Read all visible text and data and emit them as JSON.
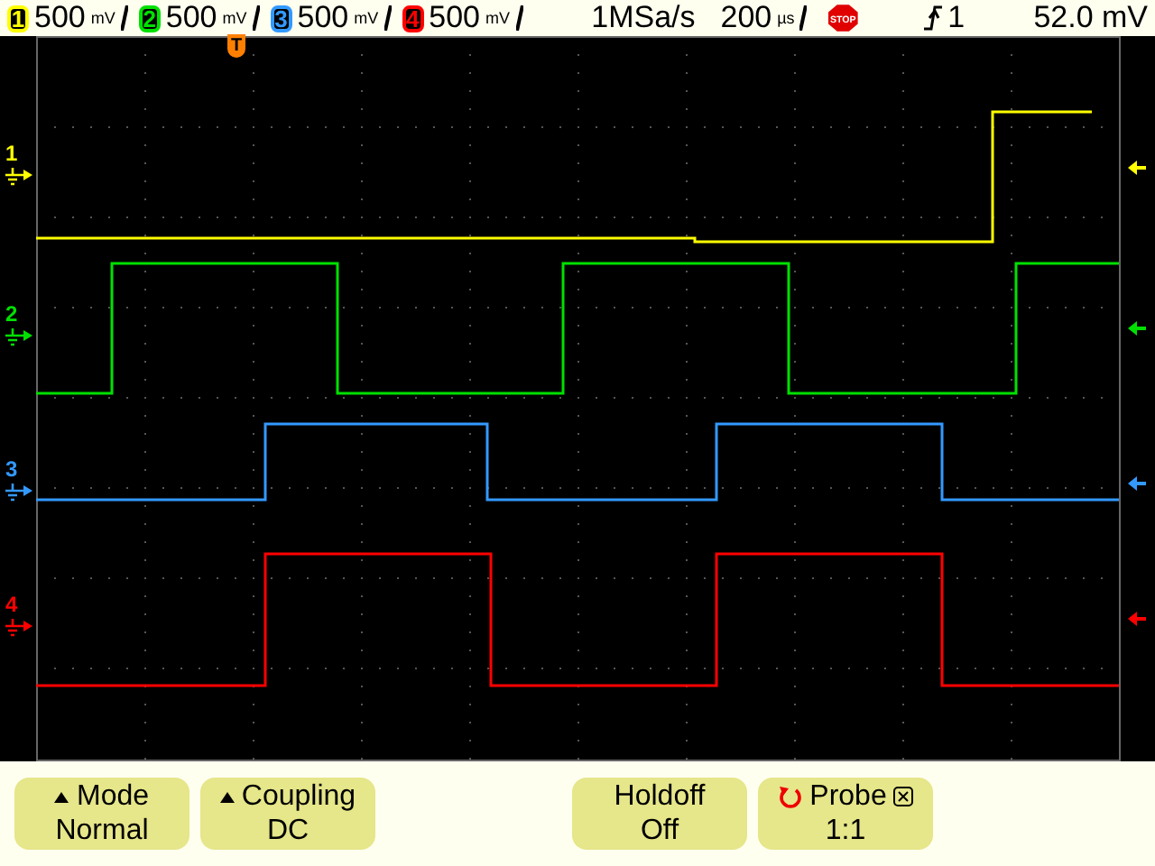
{
  "status_bar": {
    "channels": [
      {
        "number": "1",
        "color": "#ffff00",
        "scale": "500",
        "unit": "mV"
      },
      {
        "number": "2",
        "color": "#00e000",
        "scale": "500",
        "unit": "mV"
      },
      {
        "number": "3",
        "color": "#3399ff",
        "scale": "500",
        "unit": "mV"
      },
      {
        "number": "4",
        "color": "#ff0000",
        "scale": "500",
        "unit": "mV"
      }
    ],
    "sample_rate": "1MSa/s",
    "timebase": {
      "scale": "200",
      "unit": "µs"
    },
    "run_state": "STOP",
    "trigger": {
      "source": "1"
    },
    "trigger_level": "52.0 mV"
  },
  "display": {
    "trigger_marker": "T",
    "traces": [
      {
        "label": "1",
        "color": "#ffff00"
      },
      {
        "label": "2",
        "color": "#00e000"
      },
      {
        "label": "3",
        "color": "#3399ff"
      },
      {
        "label": "4",
        "color": "#ff0000"
      }
    ]
  },
  "softkeys": [
    {
      "kind": "menu",
      "label": "Mode",
      "value": "Normal"
    },
    {
      "kind": "menu",
      "label": "Coupling",
      "value": "DC"
    },
    {
      "kind": "blank"
    },
    {
      "kind": "plain",
      "label": "Holdoff",
      "value": "Off"
    },
    {
      "kind": "knob",
      "label": "Probe",
      "value": "1:1"
    }
  ]
}
